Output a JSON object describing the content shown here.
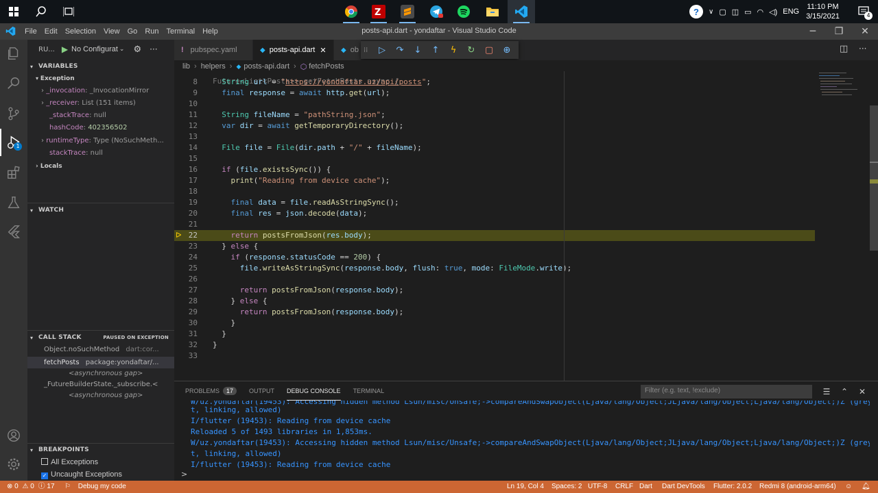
{
  "taskbar": {
    "tray": {
      "lang": "ENG",
      "notification_count": "4"
    },
    "clock": {
      "time": "11:10 PM",
      "date": "3/15/2021"
    }
  },
  "titlebar": {
    "menu": [
      "File",
      "Edit",
      "Selection",
      "View",
      "Go",
      "Run",
      "Terminal",
      "Help"
    ],
    "title": "posts-api.dart - yondaftar - Visual Studio Code"
  },
  "activity": {
    "debug_badge": "1"
  },
  "sidebar": {
    "header": {
      "run_label": "RU...",
      "config": "No Configurat"
    },
    "variables": {
      "title": "VARIABLES",
      "scope": "Exception",
      "items": [
        {
          "name": "_invocation",
          "value": "_InvocationMirror"
        },
        {
          "name": "_receiver",
          "value": "List (151 items)"
        },
        {
          "name": "_stackTrace",
          "value": "null"
        },
        {
          "name": "hashCode",
          "value": "402356502"
        },
        {
          "name": "runtimeType",
          "value": "Type (NoSuchMeth..."
        },
        {
          "name": "stackTrace",
          "value": "null"
        }
      ],
      "locals": "Locals"
    },
    "watch": {
      "title": "WATCH"
    },
    "call_stack": {
      "title": "CALL STACK",
      "status": "PAUSED ON EXCEPTION",
      "frames": [
        {
          "name": "Object.noSuchMethod",
          "source": "dart:cor..."
        },
        {
          "name": "fetchPosts",
          "source": "package:yondaftar/..."
        },
        {
          "name": "<asynchronous gap>",
          "source": ""
        },
        {
          "name": "_FutureBuilderState._subscribe.<",
          "source": ""
        },
        {
          "name": "<asynchronous gap>",
          "source": ""
        }
      ]
    },
    "breakpoints": {
      "title": "BREAKPOINTS",
      "items": [
        {
          "label": "All Exceptions",
          "checked": false
        },
        {
          "label": "Uncaught Exceptions",
          "checked": true
        }
      ]
    }
  },
  "tabs": [
    {
      "label": "pubspec.yaml",
      "active": false
    },
    {
      "label": "posts-api.dart",
      "active": true
    },
    {
      "label": "ob",
      "active": false
    }
  ],
  "breadcrumb": [
    "lib",
    "helpers",
    "posts-api.dart",
    "fetchPosts"
  ],
  "editor": {
    "partial_top": "Future<List<Posts>> getFetchPosts async {",
    "current_line": 22,
    "lines": [
      {
        "n": "8",
        "t": "  String url = \"https://yondaftar.uz/api/posts\";"
      },
      {
        "n": "9",
        "t": "  final response = await http.get(url);"
      },
      {
        "n": "10",
        "t": ""
      },
      {
        "n": "11",
        "t": "  String fileName = \"pathString.json\";"
      },
      {
        "n": "12",
        "t": "  var dir = await getTemporaryDirectory();"
      },
      {
        "n": "13",
        "t": ""
      },
      {
        "n": "14",
        "t": "  File file = File(dir.path + \"/\" + fileName);"
      },
      {
        "n": "15",
        "t": ""
      },
      {
        "n": "16",
        "t": "  if (file.existsSync()) {"
      },
      {
        "n": "17",
        "t": "    print(\"Reading from device cache\");"
      },
      {
        "n": "18",
        "t": ""
      },
      {
        "n": "19",
        "t": "    final data = file.readAsStringSync();"
      },
      {
        "n": "20",
        "t": "    final res = json.decode(data);"
      },
      {
        "n": "21",
        "t": ""
      },
      {
        "n": "22",
        "t": "    return postsFromJson(res.body);"
      },
      {
        "n": "23",
        "t": "  } else {"
      },
      {
        "n": "24",
        "t": "    if (response.statusCode == 200) {"
      },
      {
        "n": "25",
        "t": "      file.writeAsStringSync(response.body, flush: true, mode: FileMode.write);"
      },
      {
        "n": "26",
        "t": ""
      },
      {
        "n": "27",
        "t": "      return postsFromJson(response.body);"
      },
      {
        "n": "28",
        "t": "    } else {"
      },
      {
        "n": "29",
        "t": "      return postsFromJson(response.body);"
      },
      {
        "n": "30",
        "t": "    }"
      },
      {
        "n": "31",
        "t": "  }"
      },
      {
        "n": "32",
        "t": "}"
      },
      {
        "n": "33",
        "t": ""
      }
    ]
  },
  "panel": {
    "tabs": [
      {
        "label": "PROBLEMS",
        "count": "17"
      },
      {
        "label": "OUTPUT"
      },
      {
        "label": "DEBUG CONSOLE",
        "active": true
      },
      {
        "label": "TERMINAL"
      }
    ],
    "filter_placeholder": "Filter (e.g. text, !exclude)",
    "console": [
      "W/uz.yondaftar(19453): Accessing hidden method Lsun/misc/Unsafe;->compareAndSwapObject(Ljava/lang/Object;JLjava/lang/Object;Ljava/lang/Object;)Z (greylis",
      "t, linking, allowed)",
      "I/flutter (19453): Reading from device cache",
      "Reloaded 5 of 1493 libraries in 1,853ms.",
      "W/uz.yondaftar(19453): Accessing hidden method Lsun/misc/Unsafe;->compareAndSwapObject(Ljava/lang/Object;JLjava/lang/Object;Ljava/lang/Object;)Z (greylis",
      "t, linking, allowed)",
      "I/flutter (19453): Reading from device cache"
    ],
    "prompt": ">"
  },
  "statusbar": {
    "errors": "0",
    "warnings": "0",
    "infos": "17",
    "debug": "Debug my code",
    "position": "Ln 19, Col 4",
    "spaces": "Spaces: 2",
    "encoding": "UTF-8",
    "eol": "CRLF",
    "language": "Dart",
    "devtools": "Dart DevTools",
    "flutter": "Flutter: 2.0.2",
    "device": "Redmi 8 (android-arm64)"
  },
  "colors": {
    "statusbar": "#cc6633",
    "activity_bar": "#333333",
    "sidebar": "#252526",
    "editor": "#1e1e1e",
    "highlight": "#4b4b18",
    "accent": "#007acc"
  }
}
